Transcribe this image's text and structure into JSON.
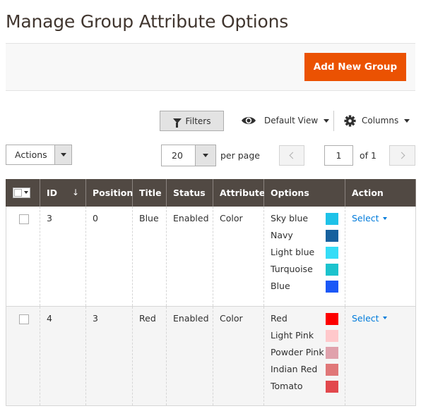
{
  "page": {
    "title": "Manage Group Attribute Options"
  },
  "header": {
    "add_button_label": "Add New Group"
  },
  "toolbar": {
    "filters_label": "Filters",
    "view_label": "Default View",
    "columns_label": "Columns",
    "actions_label": "Actions",
    "per_page_value": "20",
    "per_page_label": "per page",
    "current_page": "1",
    "total_pages_label": "of 1"
  },
  "table": {
    "columns": [
      "ID",
      "Position",
      "Title",
      "Status",
      "Attribute",
      "Options",
      "Action"
    ],
    "sort_indicator": "↓",
    "rows": [
      {
        "id": "3",
        "position": "0",
        "title": "Blue",
        "status": "Enabled",
        "attribute": "Color",
        "options": [
          {
            "label": "Sky blue",
            "color": "#1ec2e8"
          },
          {
            "label": "Navy",
            "color": "#17619e"
          },
          {
            "label": "Light blue",
            "color": "#35ddf7"
          },
          {
            "label": "Turquoise",
            "color": "#1bc3cd"
          },
          {
            "label": "Blue",
            "color": "#1b58f7"
          }
        ],
        "action_label": "Select"
      },
      {
        "id": "4",
        "position": "3",
        "title": "Red",
        "status": "Enabled",
        "attribute": "Color",
        "options": [
          {
            "label": "Red",
            "color": "#fd0000"
          },
          {
            "label": "Light Pink",
            "color": "#ffc8cb"
          },
          {
            "label": "Powder Pink",
            "color": "#e0a1ac"
          },
          {
            "label": "Indian Red",
            "color": "#e07778"
          },
          {
            "label": "Tomato",
            "color": "#e2484d"
          }
        ],
        "action_label": "Select"
      }
    ]
  },
  "colors": {
    "accent": "#eb5202",
    "header_bg": "#514943",
    "link": "#007bdb"
  },
  "icons": [
    "funnel-icon",
    "eye-icon",
    "gear-icon",
    "chevron-left-icon",
    "chevron-right-icon"
  ]
}
